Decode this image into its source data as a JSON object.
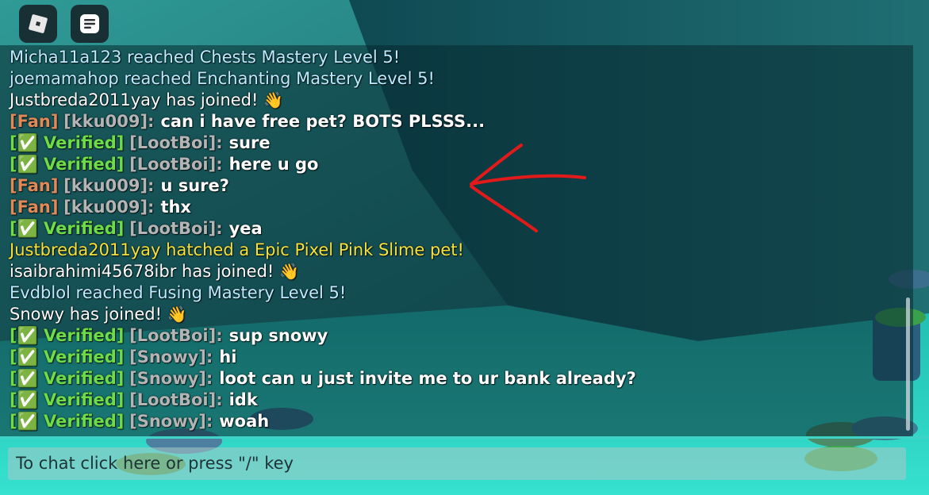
{
  "topbar": {
    "roblox_icon": "roblox-logo-icon",
    "chat_icon": "chat-bubble-icon"
  },
  "colors": {
    "fan": "#e08a5a",
    "username": "#b4b4b4",
    "verified": "#6ddc47",
    "system": "#bdeaff",
    "hatch": "#f7e23b",
    "join": "#ffffff",
    "annotation": "#e31a1a"
  },
  "chat": {
    "messages": [
      {
        "type": "system",
        "text": "Micha11a123 reached Chests Mastery Level 5!"
      },
      {
        "type": "system",
        "text": "joemamahop reached Enchanting Mastery Level 5!"
      },
      {
        "type": "join",
        "text": "Justbreda2011yay has joined!",
        "emoji": "👋"
      },
      {
        "type": "chat",
        "tag": "[Fan]",
        "user": "[kku009]:",
        "text": "can i have free pet? BOTS PLSSS..."
      },
      {
        "type": "chat",
        "tag": "[✅ Verified]",
        "user": "[LootBoi]:",
        "text": "sure"
      },
      {
        "type": "chat",
        "tag": "[✅ Verified]",
        "user": "[LootBoi]:",
        "text": "here u go"
      },
      {
        "type": "chat",
        "tag": "[Fan]",
        "user": "[kku009]:",
        "text": "u sure?"
      },
      {
        "type": "chat",
        "tag": "[Fan]",
        "user": "[kku009]:",
        "text": "thx"
      },
      {
        "type": "chat",
        "tag": "[✅ Verified]",
        "user": "[LootBoi]:",
        "text": "yea"
      },
      {
        "type": "hatch",
        "text": "Justbreda2011yay hatched a Epic Pixel Pink Slime pet!"
      },
      {
        "type": "join",
        "text": "isaibrahimi45678ibr has joined!",
        "emoji": "👋"
      },
      {
        "type": "system",
        "text": "Evdblol reached Fusing Mastery Level 5!"
      },
      {
        "type": "join",
        "text": "Snowy has joined!",
        "emoji": "👋"
      },
      {
        "type": "chat",
        "tag": "[✅ Verified]",
        "user": "[LootBoi]:",
        "text": "sup snowy"
      },
      {
        "type": "chat",
        "tag": "[✅ Verified]",
        "user": "[Snowy]:",
        "text": "hi"
      },
      {
        "type": "chat",
        "tag": "[✅ Verified]",
        "user": "[Snowy]:",
        "text": "loot can u just invite me to ur bank already?"
      },
      {
        "type": "chat",
        "tag": "[✅ Verified]",
        "user": "[LootBoi]:",
        "text": "idk"
      },
      {
        "type": "chat",
        "tag": "[✅ Verified]",
        "user": "[Snowy]:",
        "text": "woah"
      }
    ],
    "input_placeholder": "To chat click here or press \"/\" key"
  }
}
